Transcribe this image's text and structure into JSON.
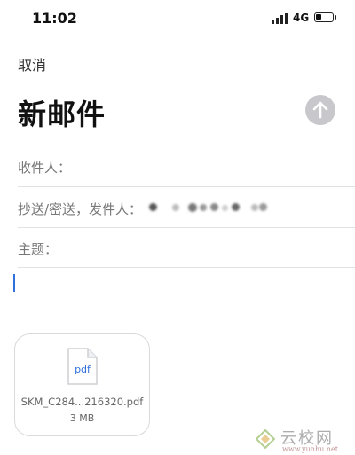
{
  "status_bar": {
    "time": "11:02",
    "network": "4G",
    "battery_level": 0.35,
    "icons": [
      "signal-icon",
      "battery-icon"
    ]
  },
  "nav": {
    "cancel_label": "取消",
    "title": "新邮件",
    "send_icon": "arrow-up-icon"
  },
  "fields": {
    "to_label": "收件人：",
    "cc_label": "抄送/密送，发件人：",
    "subject_label": "主题："
  },
  "attachment": {
    "icon_label": "pdf",
    "file_name": "SKM_C284...216320.pdf",
    "file_size": "3 MB"
  },
  "watermark": {
    "logo_text": "云校网",
    "url": "www.yunhu.net"
  },
  "colors": {
    "accent": "#2f6fde",
    "send_button": "#c8c8cc",
    "divider": "#e2e2e4",
    "label": "#777777"
  }
}
